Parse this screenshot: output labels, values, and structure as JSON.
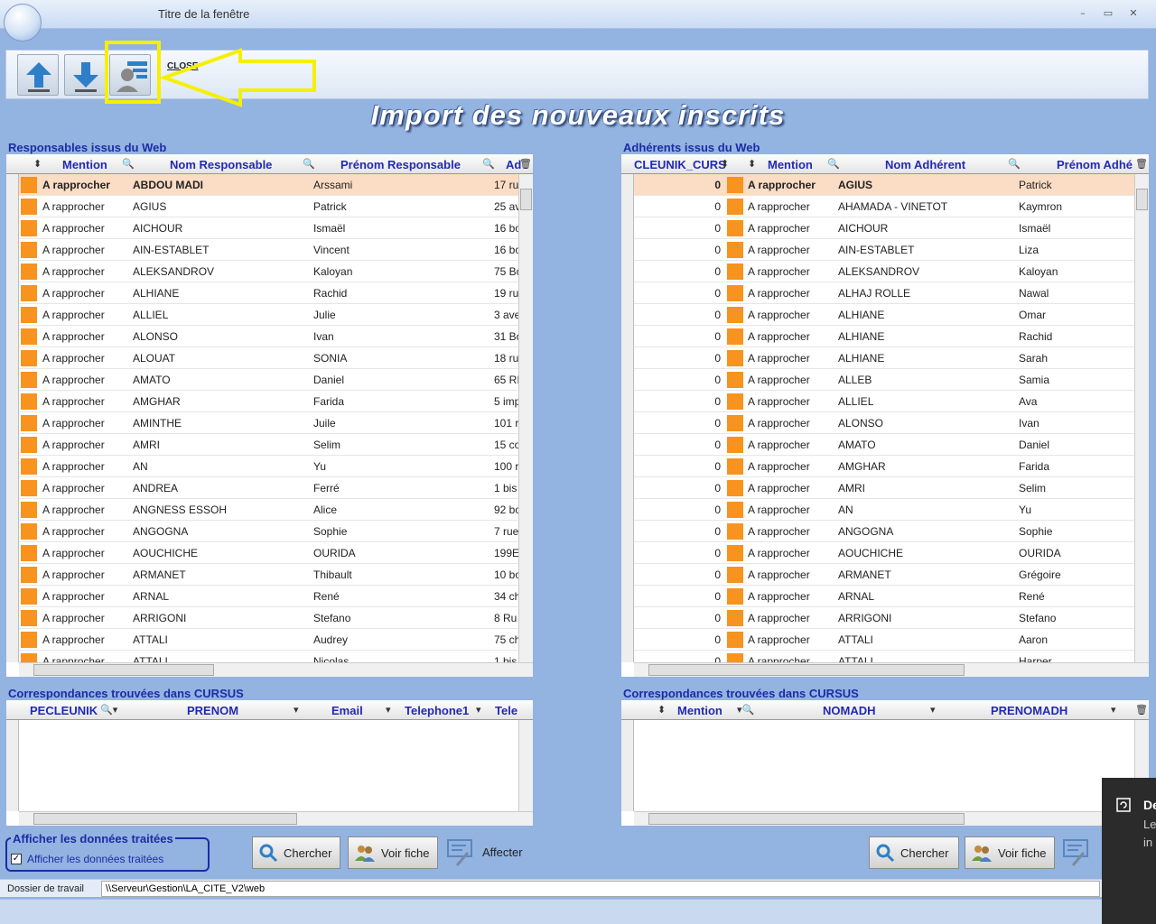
{
  "window": {
    "title": "Titre de la fenêtre",
    "min": "–",
    "max": "▭",
    "close": "✕"
  },
  "toolbar": {
    "close_label": "CLOSE"
  },
  "main_title": "Import des nouveaux inscrits",
  "left_panel": {
    "label": "Responsables issus du Web",
    "headers": [
      "Mention",
      "Nom Responsable",
      "Prénom Responsable",
      "Ad"
    ],
    "rows": [
      [
        "A rapprocher",
        "ABDOU MADI",
        "Arssami",
        "17 ru"
      ],
      [
        "A rapprocher",
        "AGIUS",
        "Patrick",
        "25 av"
      ],
      [
        "A rapprocher",
        "AICHOUR",
        "Ismaël",
        "16 bo"
      ],
      [
        "A rapprocher",
        "AIN-ESTABLET",
        "Vincent",
        "16 bo"
      ],
      [
        "A rapprocher",
        "ALEKSANDROV",
        "Kaloyan",
        "75 Bo"
      ],
      [
        "A rapprocher",
        "ALHIANE",
        "Rachid",
        "19 ru"
      ],
      [
        "A rapprocher",
        "ALLIEL",
        "Julie",
        "3 ave"
      ],
      [
        "A rapprocher",
        "ALONSO",
        "Ivan",
        "31 Bo"
      ],
      [
        "A rapprocher",
        "ALOUAT",
        "SONIA",
        "18 ru"
      ],
      [
        "A rapprocher",
        "AMATO",
        "Daniel",
        "65 RI"
      ],
      [
        "A rapprocher",
        "AMGHAR",
        "Farida",
        "5 imp"
      ],
      [
        "A rapprocher",
        "AMINTHE",
        "Juile",
        "101 r"
      ],
      [
        "A rapprocher",
        "AMRI",
        "Selim",
        "15 co"
      ],
      [
        "A rapprocher",
        "AN",
        "Yu",
        "100 r"
      ],
      [
        "A rapprocher",
        "ANDREA",
        "Ferré",
        "1 bis"
      ],
      [
        "A rapprocher",
        "ANGNESS ESSOH",
        "Alice",
        "92 bo"
      ],
      [
        "A rapprocher",
        "ANGOGNA",
        "Sophie",
        "7 rue"
      ],
      [
        "A rapprocher",
        "AOUCHICHE",
        "OURIDA",
        "199E"
      ],
      [
        "A rapprocher",
        "ARMANET",
        "Thibault",
        "10 bo"
      ],
      [
        "A rapprocher",
        "ARNAL",
        "René",
        "34 ch"
      ],
      [
        "A rapprocher",
        "ARRIGONI",
        "Stefano",
        "8 Ru"
      ],
      [
        "A rapprocher",
        "ATTALI",
        "Audrey",
        "75 ch"
      ],
      [
        "A rapprocher",
        "ATTALI",
        "Nicolas",
        "1 bis"
      ]
    ]
  },
  "right_panel": {
    "label": "Adhérents issus du Web",
    "headers": [
      "CLEUNIK_CURS",
      "Mention",
      "Nom Adhérent",
      "Prénom Adhé"
    ],
    "rows": [
      [
        "0",
        "A rapprocher",
        "AGIUS",
        "Patrick"
      ],
      [
        "0",
        "A rapprocher",
        "AHAMADA - VINETOT",
        "Kaymron"
      ],
      [
        "0",
        "A rapprocher",
        "AICHOUR",
        "Ismaël"
      ],
      [
        "0",
        "A rapprocher",
        "AIN-ESTABLET",
        "Liza"
      ],
      [
        "0",
        "A rapprocher",
        "ALEKSANDROV",
        "Kaloyan"
      ],
      [
        "0",
        "A rapprocher",
        "ALHAJ ROLLE",
        "Nawal"
      ],
      [
        "0",
        "A rapprocher",
        "ALHIANE",
        "Omar"
      ],
      [
        "0",
        "A rapprocher",
        "ALHIANE",
        "Rachid"
      ],
      [
        "0",
        "A rapprocher",
        "ALHIANE",
        "Sarah"
      ],
      [
        "0",
        "A rapprocher",
        "ALLEB",
        "Samia"
      ],
      [
        "0",
        "A rapprocher",
        "ALLIEL",
        "Ava"
      ],
      [
        "0",
        "A rapprocher",
        "ALONSO",
        "Ivan"
      ],
      [
        "0",
        "A rapprocher",
        "AMATO",
        "Daniel"
      ],
      [
        "0",
        "A rapprocher",
        "AMGHAR",
        "Farida"
      ],
      [
        "0",
        "A rapprocher",
        "AMRI",
        "Selim"
      ],
      [
        "0",
        "A rapprocher",
        "AN",
        "Yu"
      ],
      [
        "0",
        "A rapprocher",
        "ANGOGNA",
        "Sophie"
      ],
      [
        "0",
        "A rapprocher",
        "AOUCHICHE",
        "OURIDA"
      ],
      [
        "0",
        "A rapprocher",
        "ARMANET",
        "Grégoire"
      ],
      [
        "0",
        "A rapprocher",
        "ARNAL",
        "René"
      ],
      [
        "0",
        "A rapprocher",
        "ARRIGONI",
        "Stefano"
      ],
      [
        "0",
        "A rapprocher",
        "ATTALI",
        "Aaron"
      ],
      [
        "0",
        "A rapprocher",
        "ATTALI",
        "Harper"
      ]
    ]
  },
  "left_match": {
    "label": "Correspondances trouvées dans CURSUS",
    "headers": [
      "PECLEUNIK",
      "PRENOM",
      "Email",
      "Telephone1",
      "Tele"
    ]
  },
  "right_match": {
    "label": "Correspondances trouvées dans CURSUS",
    "headers": [
      "Mention",
      "NOMADH",
      "PRENOMADH"
    ]
  },
  "processed": {
    "group_label": "Afficher les données traitées",
    "checkbox_label": "Afficher les données traitées",
    "checked": "✓"
  },
  "buttons": {
    "search": "Chercher",
    "view": "Voir fiche",
    "assign": "Affecter"
  },
  "status": {
    "label": "Dossier de travail",
    "value": "\\\\Serveur\\Gestion\\LA_CITE_V2\\web"
  },
  "toast": {
    "title": "De",
    "line1": "Le",
    "line2": "in"
  }
}
